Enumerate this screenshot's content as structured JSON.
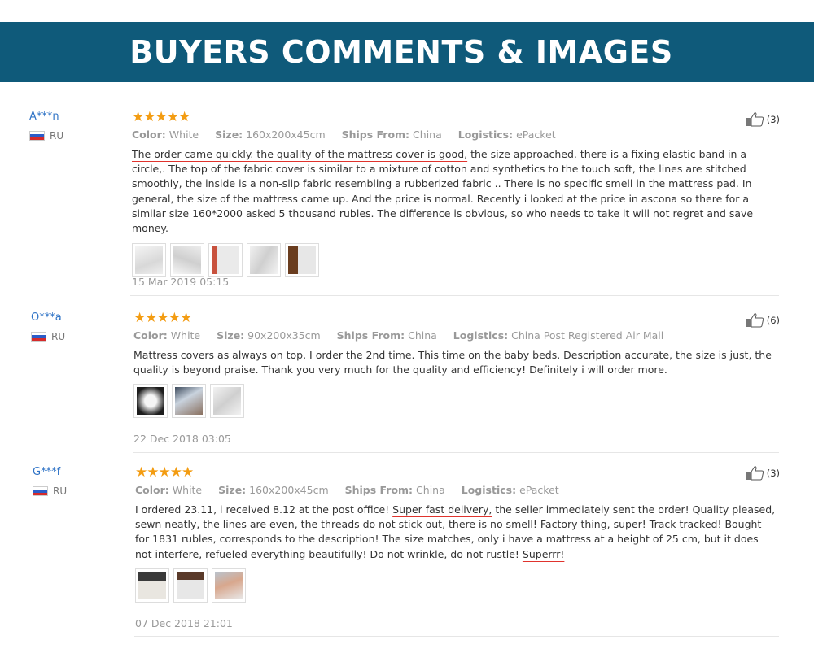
{
  "header": {
    "title": "BUYERS COMMENTS & IMAGES"
  },
  "labels": {
    "color": "Color:",
    "size": "Size:",
    "ships_from": "Ships From:",
    "logistics": "Logistics:"
  },
  "reviews": [
    {
      "user": "A***n",
      "country": "RU",
      "stars": "★★★★★",
      "likes": "(3)",
      "color": "White",
      "size": "160x200x45cm",
      "ships_from": "China",
      "logistics": "ePacket",
      "text_parts": [
        "The order came quickly. the quality of the mattress cover is good,",
        " the size approached. there is a fixing elastic band in a circle,. The top of the fabric cover is similar to a mixture of cotton and synthetics to the touch soft, the lines are stitched smoothly, the inside is a non-slip fabric resembling a rubberized fabric .. There is no specific smell in the mattress pad. In general, the size of the mattress came up. And the price is normal. Recently i looked at the price in ascona so there for a similar size 160*2000 asked 5 thousand rubles. The difference is obvious, so who needs to take it will not regret and save money."
      ],
      "date": "15 Mar 2019 05:15"
    },
    {
      "user": "O***a",
      "country": "RU",
      "stars": "★★★★★",
      "likes": "(6)",
      "color": "White",
      "size": "90x200x35cm",
      "ships_from": "China",
      "logistics": "China Post Registered Air Mail",
      "text_parts": [
        "Mattress covers as always on top. I order the 2nd time. This time on the baby beds. Description accurate, the size is just, the quality is beyond praise. Thank you very much for the quality and efficiency! ",
        "Definitely i will order more."
      ],
      "date": "22 Dec 2018 03:05"
    },
    {
      "user": "G***f",
      "country": "RU",
      "stars": "★★★★★",
      "likes": "(3)",
      "color": "White",
      "size": "160x200x45cm",
      "ships_from": "China",
      "logistics": "ePacket",
      "text_parts": [
        "I ordered 23.11, i received 8.12 at the post office! ",
        "Super fast delivery,",
        " the seller immediately sent the order! Quality pleased, sewn neatly, the lines are even, the threads do not stick out, there is no smell! Factory thing, super! Track tracked! Bought for 1831 rubles, corresponds to the description! The size matches, only i have a mattress at a height of 25 cm, but it does not interfere, refueled everything beautifully! Do not wrinkle, do not rustle! ",
        "Superrr!"
      ],
      "date": "07 Dec 2018 21:01"
    }
  ],
  "colors": {
    "banner": "#0f5a7a",
    "star": "#f39c12",
    "username": "#2f73c6",
    "underline": "#e0332d"
  }
}
